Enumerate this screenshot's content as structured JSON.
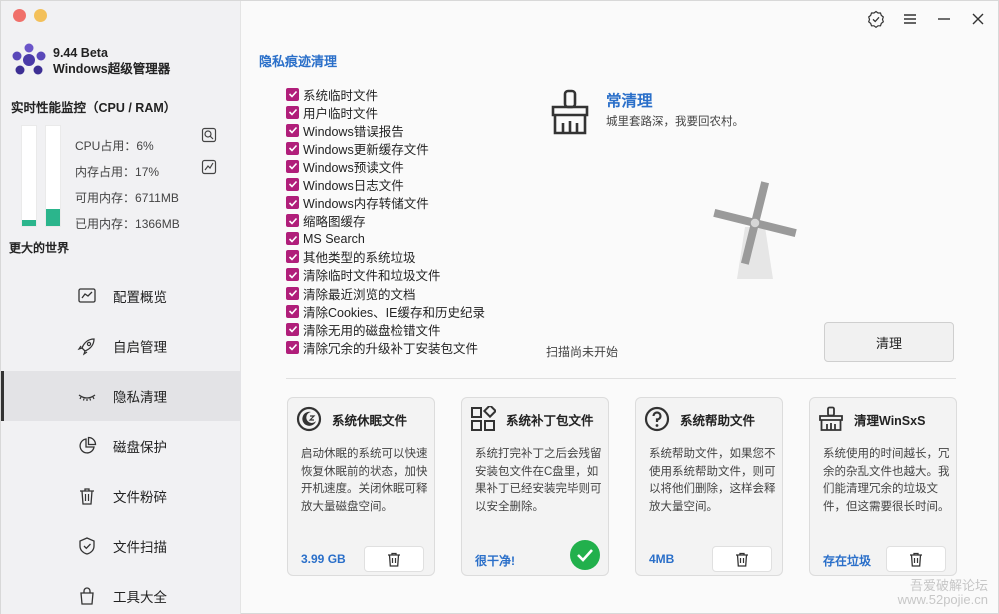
{
  "app": {
    "version": "9.44 Beta",
    "name": "Windows超级管理器"
  },
  "monitor": {
    "title": "实时性能监控（CPU / RAM）",
    "cpu_label": "CPU占用：",
    "cpu_value": "6%",
    "cpu_fraction": 0.06,
    "mem_label": "内存占用：",
    "mem_value": "17%",
    "mem_fraction": 0.17,
    "avail_label": "可用内存：",
    "avail_value": "6711MB",
    "used_label": "已用内存：",
    "used_value": "1366MB",
    "bar_color": "#2bb58c"
  },
  "slogan": "更大的世界",
  "nav": [
    {
      "label": "配置概览",
      "icon": "chart-icon"
    },
    {
      "label": "自启管理",
      "icon": "rocket-icon"
    },
    {
      "label": "隐私清理",
      "icon": "eye-closed-icon",
      "active": true
    },
    {
      "label": "磁盘保护",
      "icon": "pie-icon"
    },
    {
      "label": "文件粉碎",
      "icon": "trash-icon"
    },
    {
      "label": "文件扫描",
      "icon": "shield-icon"
    },
    {
      "label": "工具大全",
      "icon": "bag-icon"
    }
  ],
  "privacy": {
    "section_title": "隐私痕迹清理",
    "checklist": [
      "系统临时文件",
      "用户临时文件",
      "Windows错误报告",
      "Windows更新缓存文件",
      "Windows预读文件",
      "Windows日志文件",
      "Windows内存转储文件",
      "缩略图缓存",
      "MS Search",
      "其他类型的系统垃圾",
      "清除临时文件和垃圾文件",
      "清除最近浏览的文档",
      "清除Cookies、IE缓存和历史纪录",
      "清除无用的磁盘检错文件",
      "清除冗余的升级补丁安装包文件"
    ],
    "hero_title": "常清理",
    "hero_subtitle": "城里套路深，我要回农村。",
    "scan_status": "扫描尚未开始",
    "clean_button": "清理",
    "accent_color": "#2a6fc9",
    "check_color": "#b01e7a"
  },
  "cards": [
    {
      "title": "系统休眠文件",
      "icon": "moon-icon",
      "description": "启动休眠的系统可以快速恢复休眠前的状态，加快开机速度。关闭休眠可释放大量磁盘空间。",
      "value": "3.99 GB",
      "action": "trash"
    },
    {
      "title": "系统补丁包文件",
      "icon": "grid-icon",
      "description": "系统打完补丁之后会残留安装包文件在C盘里，如果补丁已经安装完毕则可以安全删除。",
      "value": "很干净!",
      "action": "ok"
    },
    {
      "title": "系统帮助文件",
      "icon": "help-icon",
      "description": "系统帮助文件，如果您不使用系统帮助文件，则可以将他们删除，这样会释放大量空间。",
      "value": "4MB",
      "action": "trash"
    },
    {
      "title": "清理WinSxS",
      "icon": "broom-icon",
      "description": "系统使用的时间越长，冗余的杂乱文件也越大。我们能清理冗余的垃圾文件，但这需要很长时间。",
      "value": "存在垃圾",
      "action": "trash"
    }
  ],
  "watermark": {
    "line1": "吾爱破解论坛",
    "line2": "www.52pojie.cn"
  }
}
